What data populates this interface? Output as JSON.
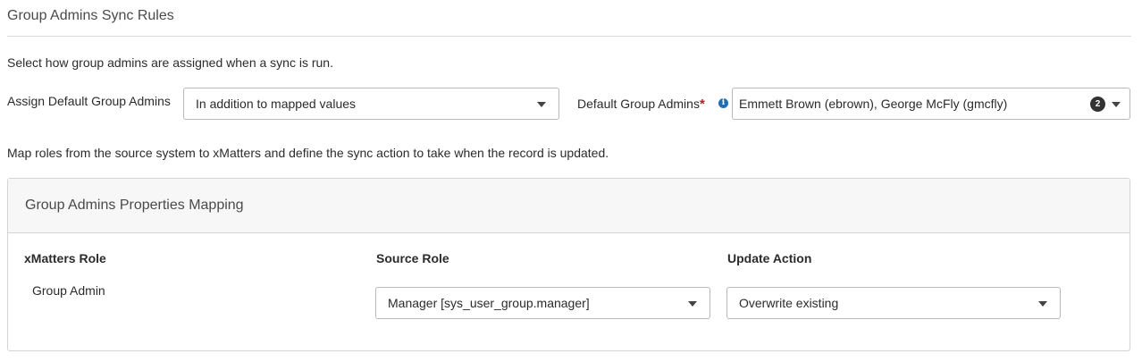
{
  "section": {
    "title": "Group Admins Sync Rules",
    "description": "Select how group admins are assigned when a sync is run."
  },
  "assign_default": {
    "label": "Assign Default Group Admins",
    "selected": "In addition to mapped values"
  },
  "default_admins": {
    "label": "Default Group Admins",
    "required_marker": "*",
    "info_icon": "i",
    "value": "Emmett Brown (ebrown), George McFly (gmcfly)",
    "count": "2"
  },
  "mapping_description": "Map roles from the source system to xMatters and define the sync action to take when the record is updated.",
  "panel": {
    "title": "Group Admins Properties Mapping",
    "columns": {
      "xmatters_role": "xMatters Role",
      "source_role": "Source Role",
      "update_action": "Update Action"
    },
    "rows": [
      {
        "xmatters_role": "Group Admin",
        "source_role": "Manager [sys_user_group.manager]",
        "update_action": "Overwrite existing"
      }
    ]
  }
}
